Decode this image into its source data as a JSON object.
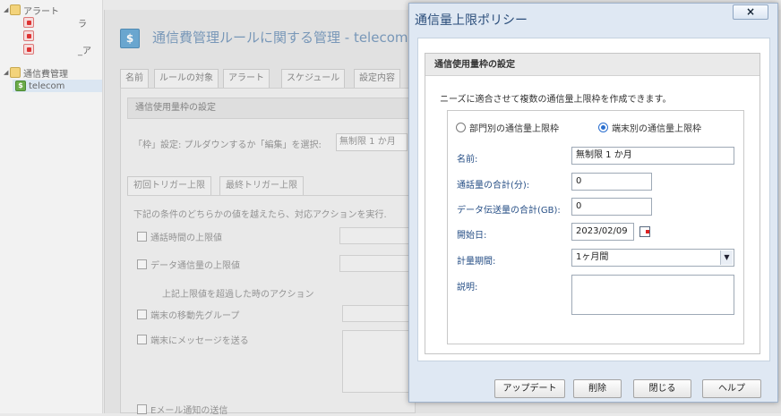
{
  "tree": {
    "items": [
      {
        "label": "アラート",
        "icon": "folder-icon"
      },
      {
        "label": "ラ",
        "icon": "alert-icon"
      },
      {
        "label": "",
        "icon": "alert-icon"
      },
      {
        "label": "_ア",
        "icon": "alert-icon"
      },
      {
        "label": "通信費管理",
        "icon": "folder-icon"
      },
      {
        "label": "telecom",
        "icon": "dollar-icon"
      }
    ]
  },
  "main": {
    "title": "通信費管理ルールに関する管理 - telecom",
    "tabs": [
      "名前",
      "ルールの対象",
      "アラート",
      "スケジュール",
      "設定内容"
    ],
    "section_head": "通信使用量枠の設定",
    "limit_label": "「枠」設定: プルダウンするか「編集」を選択:",
    "limit_value": "無制限 1 か月",
    "subtabs": [
      "初回トリガー上限",
      "最終トリガー上限"
    ],
    "condition_text": "下記の条件のどちらかの値を越えたら、対応アクションを実行.",
    "checks": {
      "call_limit": "通話時間の上限値",
      "data_limit": "データ通信量の上限値",
      "action_text": "上記上限値を超過した時のアクション",
      "move_group": "端末の移動先グループ",
      "send_message": "端末にメッセージを送る",
      "email_notify": "Eメール通知の送信"
    }
  },
  "dialog": {
    "title": "通信量上限ポリシー",
    "close_label": "×",
    "section_head": "通信使用量枠の設定",
    "description": "ニーズに適合させて複数の通信量上限枠を作成できます。",
    "radio_dept": "部門別の通信量上限枠",
    "radio_device": "端末別の通信量上限枠",
    "fields": {
      "name_label": "名前:",
      "name_value": "無制限 1 か月",
      "call_label": "通話量の合計(分):",
      "call_value": "0",
      "data_label": "データ伝送量の合計(GB):",
      "data_value": "0",
      "start_label": "開始日:",
      "start_value": "2023/02/09",
      "period_label": "計量期間:",
      "period_value": "1ヶ月間",
      "desc_label": "説明:",
      "desc_value": ""
    },
    "buttons": {
      "update": "アップデート",
      "delete": "削除",
      "close": "閉じる",
      "help": "ヘルプ"
    }
  }
}
